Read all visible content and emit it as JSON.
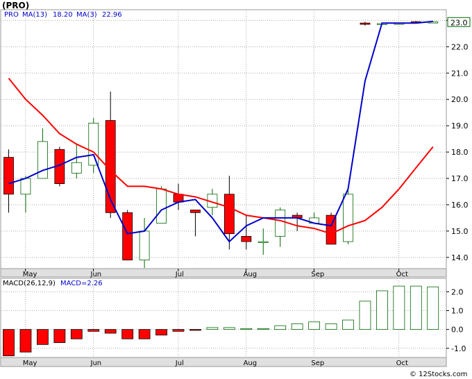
{
  "header": {
    "symbol_label": "(PRO)",
    "ticker": "PRO",
    "ma13_label": "MA(13)",
    "ma13_value": "18.20",
    "ma3_label": "MA(3)",
    "ma3_value": "22.96",
    "macd_label": "MACD(26,12,9)",
    "macd_value_label": "MACD=2.26",
    "price_tag": "23.0",
    "watermark": "© 12Stocks.com"
  },
  "colors": {
    "up": "#ffffff",
    "up_border": "#006600",
    "down": "#ff0000",
    "ma13": "#ff0000",
    "ma3": "#0000cc",
    "macd_pos": "#ffffff",
    "macd_pos_border": "#006600",
    "macd_neg": "#ff0000",
    "grid": "#aaaaaa",
    "axis_bg": "#e0e0e0",
    "tag_bg": "#ffffff",
    "tag_border": "#006600"
  },
  "chart_data": [
    {
      "type": "candlestick",
      "grid": true,
      "yaxis": {
        "side": "right",
        "ylim": [
          13.6,
          23.3
        ],
        "ticks": [
          14.0,
          15.0,
          16.0,
          17.0,
          18.0,
          19.0,
          20.0,
          21.0,
          22.0,
          23.0
        ]
      },
      "xaxis": {
        "ticks": [
          "May",
          "Jun",
          "Jul",
          "Aug",
          "Sep",
          "Oct"
        ],
        "tick_bar_index": [
          1,
          5,
          10,
          14,
          18,
          23
        ]
      },
      "bars": [
        {
          "o": 17.8,
          "h": 18.1,
          "l": 15.7,
          "c": 16.4
        },
        {
          "o": 16.4,
          "h": 17.1,
          "l": 15.7,
          "c": 17.0
        },
        {
          "o": 17.0,
          "h": 18.9,
          "l": 17.0,
          "c": 18.4
        },
        {
          "o": 18.1,
          "h": 18.2,
          "l": 16.7,
          "c": 16.8
        },
        {
          "o": 17.2,
          "h": 18.3,
          "l": 17.0,
          "c": 17.6
        },
        {
          "o": 17.5,
          "h": 19.3,
          "l": 17.2,
          "c": 19.1
        },
        {
          "o": 19.2,
          "h": 20.3,
          "l": 15.5,
          "c": 15.7
        },
        {
          "o": 15.7,
          "h": 15.8,
          "l": 13.9,
          "c": 13.9
        },
        {
          "o": 13.9,
          "h": 15.5,
          "l": 13.6,
          "c": 15.0
        },
        {
          "o": 15.3,
          "h": 16.7,
          "l": 15.3,
          "c": 16.6
        },
        {
          "o": 16.4,
          "h": 16.8,
          "l": 15.8,
          "c": 16.1
        },
        {
          "o": 15.8,
          "h": 15.8,
          "l": 14.8,
          "c": 15.7
        },
        {
          "o": 15.9,
          "h": 16.6,
          "l": 15.6,
          "c": 16.4
        },
        {
          "o": 16.4,
          "h": 17.1,
          "l": 14.3,
          "c": 14.9
        },
        {
          "o": 14.8,
          "h": 15.6,
          "l": 14.3,
          "c": 14.6
        },
        {
          "o": 14.6,
          "h": 15.1,
          "l": 14.1,
          "c": 14.6
        },
        {
          "o": 14.8,
          "h": 15.9,
          "l": 14.4,
          "c": 15.8
        },
        {
          "o": 15.6,
          "h": 15.7,
          "l": 15.0,
          "c": 15.5
        },
        {
          "o": 15.3,
          "h": 15.7,
          "l": 15.3,
          "c": 15.5
        },
        {
          "o": 15.6,
          "h": 15.7,
          "l": 14.5,
          "c": 14.5
        },
        {
          "o": 14.6,
          "h": 16.7,
          "l": 14.5,
          "c": 16.4
        },
        {
          "o": 22.9,
          "h": 22.95,
          "l": 22.8,
          "c": 22.85
        },
        {
          "o": 22.85,
          "h": 22.9,
          "l": 22.85,
          "c": 22.88
        },
        {
          "o": 22.85,
          "h": 22.9,
          "l": 22.85,
          "c": 22.9
        },
        {
          "o": 22.95,
          "h": 22.98,
          "l": 22.9,
          "c": 22.9
        },
        {
          "o": 22.9,
          "h": 22.95,
          "l": 22.9,
          "c": 22.95
        }
      ],
      "ma13": [
        20.8,
        20.0,
        19.4,
        18.7,
        18.3,
        18.0,
        17.3,
        16.7,
        16.7,
        16.6,
        16.4,
        16.3,
        16.1,
        15.9,
        15.6,
        15.5,
        15.4,
        15.2,
        15.1,
        14.9,
        15.2,
        15.4,
        15.9,
        16.6,
        17.4,
        18.2
      ],
      "ma13_start_index": 0,
      "ma3": [
        16.8,
        17.0,
        17.3,
        17.5,
        17.8,
        17.9,
        16.2,
        14.9,
        15.0,
        15.8,
        16.1,
        16.2,
        15.5,
        14.6,
        15.2,
        15.5,
        15.5,
        15.5,
        15.3,
        15.2,
        16.6,
        20.7,
        22.9,
        22.9,
        22.9,
        22.96
      ],
      "ma3_start_index": 0
    },
    {
      "type": "bar",
      "title": "MACD(26,12,9)",
      "yaxis": {
        "side": "right",
        "ylim": [
          -1.45,
          2.6
        ],
        "ticks": [
          -1.0,
          0.0,
          1.0,
          2.0
        ]
      },
      "values": [
        -1.4,
        -1.2,
        -0.8,
        -0.7,
        -0.5,
        -0.1,
        -0.2,
        -0.5,
        -0.5,
        -0.3,
        -0.1,
        -0.05,
        0.1,
        0.1,
        0.05,
        0.05,
        0.2,
        0.3,
        0.4,
        0.3,
        0.5,
        1.5,
        2.05,
        2.3,
        2.3,
        2.26
      ]
    }
  ]
}
